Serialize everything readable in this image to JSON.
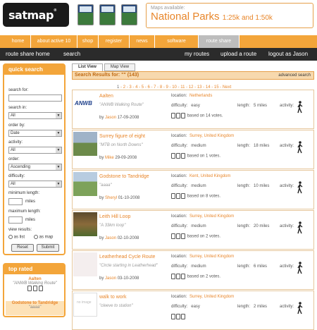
{
  "header": {
    "logo_text": "satmap",
    "logo_mark": "®",
    "banner_small": "Maps available:",
    "banner_big": "National Parks",
    "banner_sub": "1:25k and 1:50k"
  },
  "nav": {
    "tabs": [
      "home",
      "about active 10",
      "shop",
      "register",
      "news",
      "software",
      "route share"
    ],
    "active_tab": "route share"
  },
  "subnav": {
    "left": [
      "route share home",
      "search"
    ],
    "right": [
      "my routes",
      "upload a route",
      "logout as Jason"
    ]
  },
  "quick_search": {
    "title": "quick search",
    "search_for_label": "search for:",
    "search_for_value": "",
    "search_in_label": "search in:",
    "search_in_value": "All",
    "order_by_label": "order by:",
    "order_by_value": "Date",
    "activity_label": "activity:",
    "activity_value": "All",
    "order_label": "order:",
    "order_value": "Ascending",
    "difficulty_label": "difficulty:",
    "difficulty_value": "All",
    "min_length_label": "minimum length:",
    "max_length_label": "maximum length:",
    "miles_label": "miles",
    "view_results_label": "view results:",
    "as_list_label": "as list",
    "as_map_label": "as map",
    "reset_label": "Reset",
    "submit_label": "Submit"
  },
  "top_rated": {
    "title": "top rated",
    "items": [
      {
        "name": "Aalten",
        "desc": "\"ANWB Walking Route\""
      },
      {
        "name": "Godstone to Tandridge",
        "desc": "\"aaaa\""
      }
    ]
  },
  "view_tabs": {
    "list": "List View",
    "map": "Map View"
  },
  "results": {
    "heading": "Search Results for: \"\" (143)",
    "advanced_link": "advanced search",
    "pages": [
      "1",
      "2",
      "3",
      "4",
      "5",
      "6",
      "7",
      "8",
      "9",
      "10",
      "11",
      "12",
      "13",
      "14",
      "15"
    ],
    "current_page": "1",
    "next_label": "Next",
    "location_label": "location:",
    "difficulty_label": "difficulty:",
    "length_label": "length:",
    "activity_label": "activity:",
    "by_label": "by",
    "rows": [
      {
        "name": "Aalten",
        "desc": "\"ANWB Walking Route\"",
        "author": "Jason",
        "date": "17-09-2008",
        "location": "Netherlands",
        "difficulty": "easy",
        "length": "5 miles",
        "votes": "based on 14 votes.",
        "thumb": "anwb"
      },
      {
        "name": "Surrey figure of eight",
        "desc": "\"MTB on North Downs\"",
        "author": "Mike",
        "date": "29-09-2008",
        "location": "Surrey, United Kingdom",
        "difficulty": "medium",
        "length": "18 miles",
        "votes": "based on 1 votes.",
        "thumb": "bike"
      },
      {
        "name": "Godstone to Tandridge",
        "desc": "\"aaaa\"",
        "author": "Sheryl",
        "date": "01-10-2008",
        "location": "Kent, United Kingdom",
        "difficulty": "medium",
        "length": "10 miles",
        "votes": "based on 8 votes.",
        "thumb": "field"
      },
      {
        "name": "Leith Hill Loop",
        "desc": "\"A 33km loop\"",
        "author": "Jason",
        "date": "02-10-2008",
        "location": "Surrey, United Kingdom",
        "difficulty": "medium",
        "length": "20 miles",
        "votes": "based on 2 votes.",
        "thumb": "woods"
      },
      {
        "name": "Leatherhead Cycle Route",
        "desc": "\"Circle starting in Leatherhead\"",
        "author": "Jason",
        "date": "03-10-2008",
        "location": "Surrey, United Kingdom",
        "difficulty": "medium",
        "length": "6 miles",
        "votes": "based on 2 votes.",
        "thumb": "blank"
      },
      {
        "name": "walk to work",
        "desc": "\"cleeve to station\"",
        "author": "",
        "date": "",
        "location": "Surrey, United Kingdom",
        "difficulty": "easy",
        "length": "2 miles",
        "votes": "",
        "thumb": "noimage"
      }
    ]
  }
}
